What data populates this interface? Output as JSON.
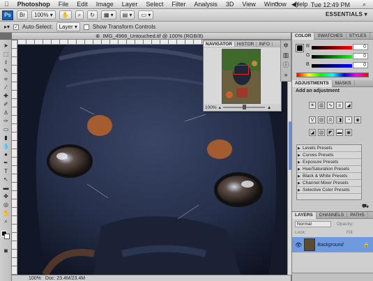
{
  "menubar": {
    "apple": "",
    "app": "Photoshop",
    "items": [
      "File",
      "Edit",
      "Image",
      "Layer",
      "Select",
      "Filter",
      "Analysis",
      "3D",
      "View",
      "Window",
      "Help"
    ],
    "clock": "Tue 12:49 PM"
  },
  "appbar": {
    "logo": "Ps",
    "zoom": "100%",
    "workspace": "ESSENTIALS ▾"
  },
  "options": {
    "auto_select_label": "Auto-Select:",
    "auto_select_value": "Layer",
    "transform_label": "Show Transform Controls"
  },
  "document": {
    "tab_title": "IMG_4966_Untouched.tif @ 100% (RGB/8)",
    "zoom_status": "100%",
    "doc_info": "Doc: 23.4M/23.4M"
  },
  "navigator": {
    "tabs": [
      "NAVIGATOR",
      "HISTOGRAM",
      "INFO"
    ],
    "tab_short": [
      "NAVIGATOR",
      "HISTOR",
      "INFO"
    ],
    "zoom": "100%"
  },
  "color_panel": {
    "tabs": [
      "COLOR",
      "SWATCHES",
      "STYLES"
    ],
    "channels": [
      {
        "label": "R",
        "value": "0"
      },
      {
        "label": "G",
        "value": "0"
      },
      {
        "label": "B",
        "value": "0"
      }
    ]
  },
  "adjustments": {
    "tabs": [
      "ADJUSTMENTS",
      "MASKS"
    ],
    "title": "Add an adjustment",
    "presets": [
      "Levels Presets",
      "Curves Presets",
      "Exposure Presets",
      "Hue/Saturation Presets",
      "Black & White Presets",
      "Channel Mixer Presets",
      "Selective Color Presets"
    ]
  },
  "layers_panel": {
    "tabs": [
      "LAYERS",
      "CHANNELS",
      "PATHS"
    ],
    "blend_mode": "Normal",
    "opacity_label": "Opacity:",
    "lock_label": "Lock:",
    "fill_label": "Fill:",
    "layer_name": "Background"
  },
  "colors": {
    "selected_layer": "#6f9ae0",
    "accent": "#1d5ea8"
  }
}
